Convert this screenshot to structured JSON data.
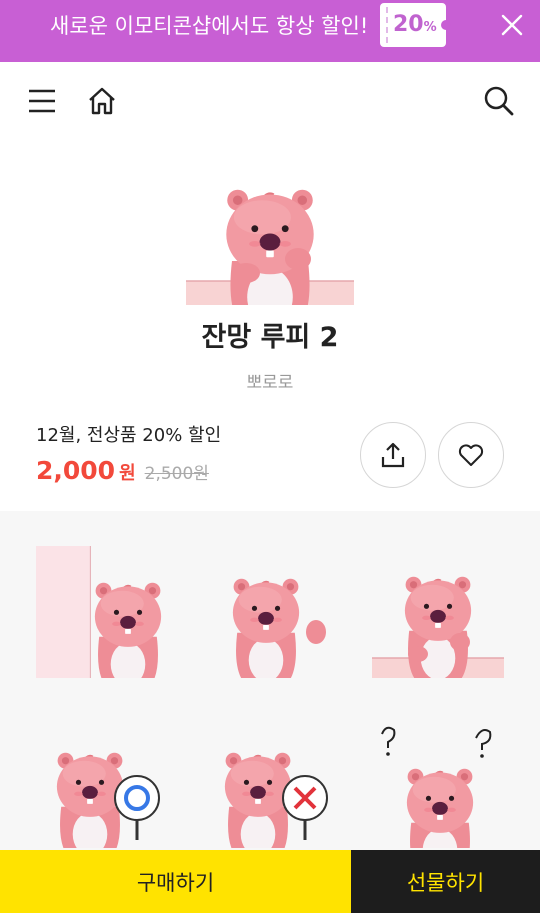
{
  "promo_banner": {
    "text": "새로운 이모티콘샵에서도 항상 할인!",
    "coupon_value": "20",
    "coupon_unit": "%",
    "icon": "close-icon",
    "color": "#c85fd4"
  },
  "header": {
    "icons": [
      "menu-icon",
      "home-icon",
      "search-icon"
    ]
  },
  "product": {
    "title": "잔망 루피 2",
    "author": "뽀로로",
    "promo_label": "12월, 전상품 20% 할인",
    "price": "2,000",
    "price_unit": "원",
    "original_price": "2,500원",
    "price_color": "#f2493b",
    "actions": [
      "share-icon",
      "heart-icon"
    ]
  },
  "stickers": {
    "count_visible": 6,
    "items": [
      "loopy-peeking-behind-wall",
      "loopy-waving",
      "loopy-leaning-on-ledge",
      "loopy-holding-o-sign",
      "loopy-holding-x-sign",
      "loopy-dizzy-with-question-marks"
    ]
  },
  "bottom_bar": {
    "buy_label": "구매하기",
    "gift_label": "선물하기",
    "buy_color": "#ffe300",
    "gift_color": "#1d1d1d"
  }
}
